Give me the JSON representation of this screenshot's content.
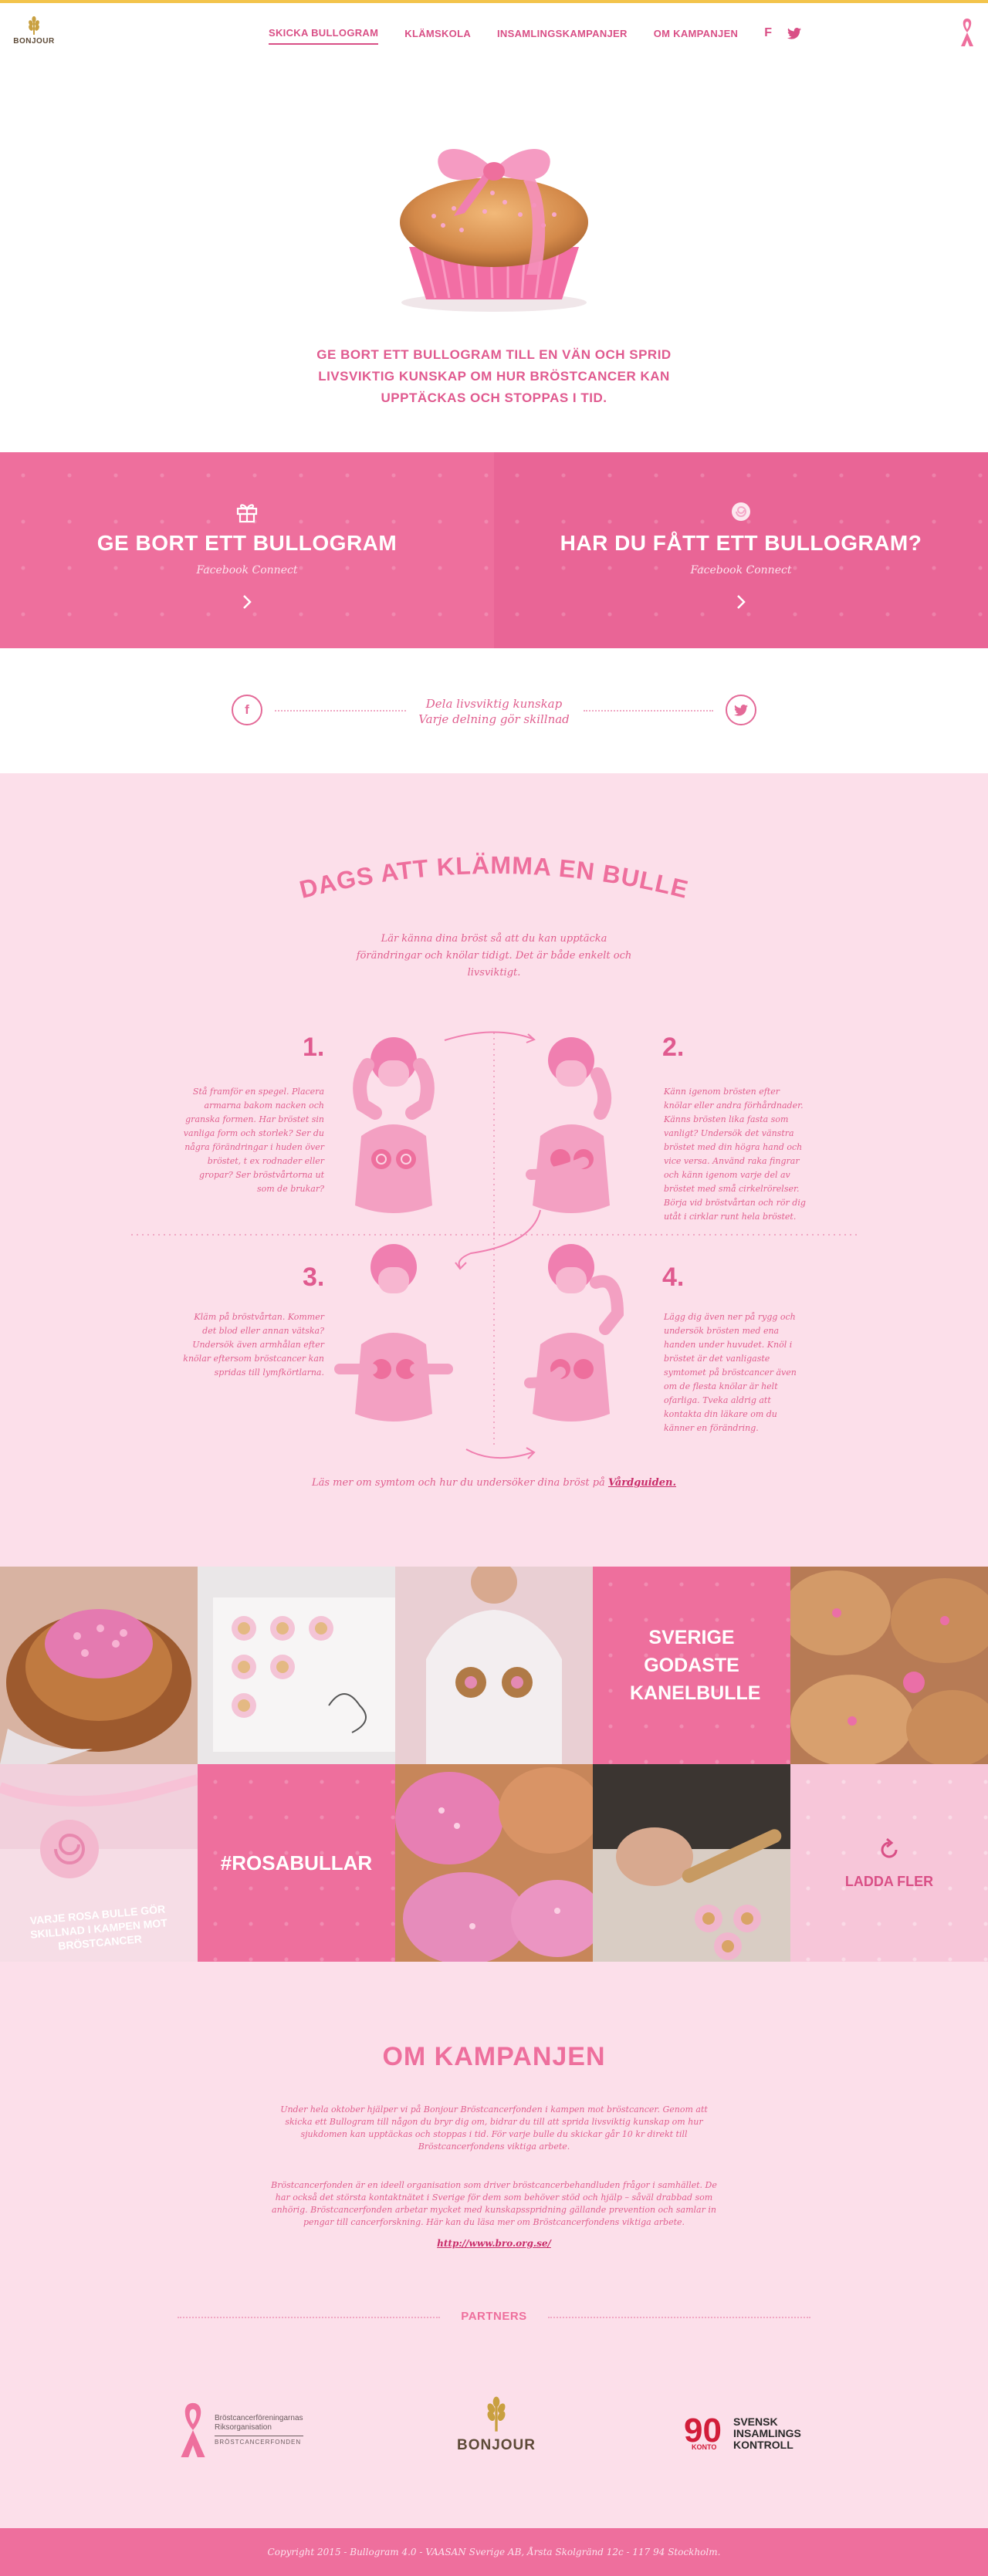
{
  "brand": {
    "logo_text": "BONJOUR",
    "accent": "#ee6f9d",
    "text_pink": "#e0608f",
    "gold": "#f3c44c"
  },
  "nav": {
    "items": [
      "SKICKA BULLOGRAM",
      "KLÄMSKOLA",
      "INSAMLINGSKAMPANJER",
      "OM KAMPANJEN"
    ],
    "facebook": "f",
    "twitter": "twitter-icon"
  },
  "hero": {
    "text": "GE BORT ETT BULLOGRAM TILL EN VÄN OCH SPRID LIVSVIKTIG KUNSKAP OM HUR BRÖSTCANCER KAN UPPTÄCKAS OCH STOPPAS I TID."
  },
  "cta": {
    "left": {
      "title": "GE BORT ETT BULLOGRAM",
      "sub": "Facebook Connect",
      "icon": "gift-icon"
    },
    "right": {
      "title": "HAR DU FÅTT ETT BULLOGRAM?",
      "sub": "Facebook Connect",
      "icon": "bun-icon"
    }
  },
  "share": {
    "line1": "Dela livsviktig kunskap",
    "line2": "Varje delning gör skillnad",
    "facebook": "f"
  },
  "klam": {
    "title": "DAGS ATT KLÄMMA EN BULLE",
    "intro": "Lär känna dina bröst så att du kan upptäcka förändringar och knölar tidigt. Det är både enkelt och livsviktigt.",
    "steps": [
      {
        "num": "1.",
        "text": "Stå framför en spegel. Placera armarna bakom nacken och granska formen. Har bröstet sin vanliga form och storlek? Ser du några förändringar i huden över bröstet, t ex rodnader eller gropar? Ser bröstvårtorna ut som de brukar?"
      },
      {
        "num": "2.",
        "text": "Känn igenom brösten efter knölar eller andra förhårdnader. Känns brösten lika fasta som vanligt? Undersök det vänstra bröstet med din högra hand och vice versa. Använd raka fingrar och känn igenom varje del av bröstet med små cirkelrörelser. Börja vid bröstvårtan och rör dig utåt i cirklar runt hela bröstet."
      },
      {
        "num": "3.",
        "text": "Kläm på bröstvårtan. Kommer det blod eller annan vätska? Undersök även armhålan efter knölar eftersom bröstcancer kan spridas till lymfkörtlarna."
      },
      {
        "num": "4.",
        "text": "Lägg dig även ner på rygg och undersök brösten med ena handen under huvudet. Knöl i bröstet är det vanligaste symtomet på bröstcancer även om de flesta knölar är helt ofarliga. Tveka aldrig att kontakta din läkare om du känner en förändring."
      }
    ],
    "more_text": "Läs mer om symtom och hur du undersöker dina bröst på",
    "more_link": "Vårdguiden."
  },
  "grid": {
    "tile_sverige": "SVERIGE GODASTE KANELBULLE",
    "tile_hashtag": "#ROSABULLAR",
    "tile_more": "LADDA FLER",
    "caption": "VARJE ROSA BULLE GÖR SKILLNAD I KAMPEN MOT BRÖSTCANCER"
  },
  "om": {
    "title": "OM KAMPANJEN",
    "p1": "Under hela oktober hjälper vi på Bonjour Bröstcancerfonden i kampen mot bröstcancer. Genom att skicka ett Bullogram till någon du bryr dig om, bidrar du till att sprida livsviktig kunskap om hur sjukdomen kan upptäckas och stoppas i tid. För varje bulle du skickar går 10 kr direkt till Bröstcancerfondens viktiga arbete.",
    "p2": "Bröstcancerfonden är en ideell organisation som driver bröstcancerbehandluden frågor i samhället. De har också det största kontaktnätet i Sverige för dem som behöver stöd och hjälp – såväl drabbad som anhörig. Bröstcancerfonden arbetar mycket med kunskapsspridning gällande prevention och samlar in pengar till cancerforskning. Här kan du läsa mer om Bröstcancerfondens viktiga arbete.",
    "link": "http://www.bro.org.se/",
    "partners_label": "PARTNERS",
    "partner1_line1": "Bröstcancerföreningarnas",
    "partner1_line2": "Riksorganisation",
    "partner1_line3": "BRÖSTCANCERFONDEN",
    "partner2": "BONJOUR",
    "partner3_num": "90",
    "partner3_konto": "KONTO",
    "partner3_line1": "SVENSK",
    "partner3_line2": "INSAMLINGS",
    "partner3_line3": "KONTROLL"
  },
  "footer": {
    "text": "Copyright 2015 - Bullogram 4.0 - VAASAN Sverige AB, Årsta Skolgränd 12c - 117 94 Stockholm."
  }
}
